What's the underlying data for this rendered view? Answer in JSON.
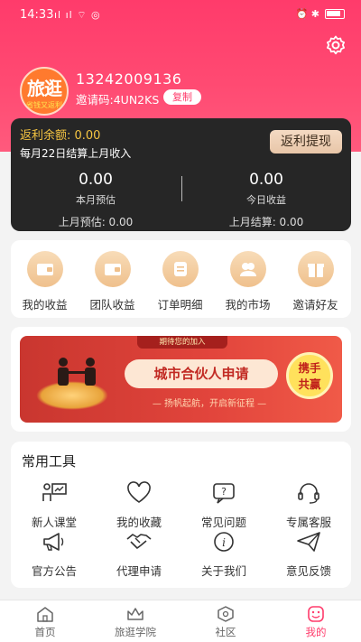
{
  "status_bar": {
    "time": "14:33",
    "signal": "ıl ıl ⌔ ◎",
    "right_icons": "⏰ ✱"
  },
  "colors": {
    "accent": "#ff3b6b",
    "gold": "#f5c542",
    "card_dark": "#262626"
  },
  "profile": {
    "avatar_text": "旅逛",
    "avatar_subtext": "省钱又返利",
    "phone": "13242009136",
    "invite_code": "邀请码:4UN2KS",
    "copy_label": "复制"
  },
  "rebate": {
    "balance_label": "返利余额: 0.00",
    "settle_note": "每月22日结算上月收入",
    "withdraw_label": "返利提现",
    "left": {
      "value": "0.00",
      "label": "本月预估",
      "sub": "上月预估: 0.00"
    },
    "right": {
      "value": "0.00",
      "label": "今日收益",
      "sub": "上月结算: 0.00"
    }
  },
  "quick_links": [
    {
      "label": "我的收益",
      "icon": "wallet-icon"
    },
    {
      "label": "团队收益",
      "icon": "wallet-icon"
    },
    {
      "label": "订单明细",
      "icon": "order-icon"
    },
    {
      "label": "我的市场",
      "icon": "people-icon"
    },
    {
      "label": "邀请好友",
      "icon": "gift-icon"
    }
  ],
  "banner": {
    "tag": "期待您的加入",
    "title": "城市合伙人申请",
    "slogan": "— 扬帆起航，开启新征程 —",
    "badge_line1": "携手",
    "badge_line2": "共赢"
  },
  "tools": {
    "title": "常用工具",
    "items": [
      {
        "label": "新人课堂",
        "icon": "classroom-icon"
      },
      {
        "label": "我的收藏",
        "icon": "heart-icon"
      },
      {
        "label": "常见问题",
        "icon": "faq-icon"
      },
      {
        "label": "专属客服",
        "icon": "headset-icon"
      },
      {
        "label": "官方公告",
        "icon": "megaphone-icon"
      },
      {
        "label": "代理申请",
        "icon": "handshake-icon"
      },
      {
        "label": "关于我们",
        "icon": "info-icon"
      },
      {
        "label": "意见反馈",
        "icon": "send-icon"
      }
    ]
  },
  "tabbar": [
    {
      "label": "首页",
      "icon": "home-icon"
    },
    {
      "label": "旅逛学院",
      "icon": "crown-icon"
    },
    {
      "label": "社区",
      "icon": "hexagon-icon"
    },
    {
      "label": "我的",
      "icon": "smile-icon",
      "active": true
    }
  ]
}
